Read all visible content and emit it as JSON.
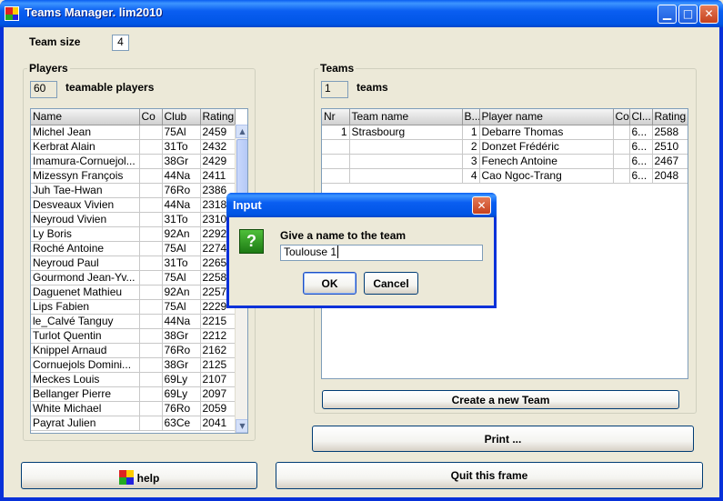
{
  "window": {
    "title": "Teams Manager. lim2010",
    "controls": [
      "minimize",
      "maximize",
      "close"
    ]
  },
  "team_size": {
    "label": "Team size",
    "value": "4"
  },
  "players": {
    "group_title": "Players",
    "count": "60",
    "count_label": "teamable players",
    "columns": [
      "Name",
      "Co",
      "Club",
      "Rating"
    ],
    "rows": [
      [
        "Michel Jean",
        "",
        "75Al",
        "2459"
      ],
      [
        "Kerbrat Alain",
        "",
        "31To",
        "2432"
      ],
      [
        "Imamura-Cornuejol...",
        "",
        "38Gr",
        "2429"
      ],
      [
        "Mizessyn François",
        "",
        "44Na",
        "2411"
      ],
      [
        "Juh Tae-Hwan",
        "",
        "76Ro",
        "2386"
      ],
      [
        "Desveaux Vivien",
        "",
        "44Na",
        "2318"
      ],
      [
        "Neyroud Vivien",
        "",
        "31To",
        "2310"
      ],
      [
        "Ly Boris",
        "",
        "92An",
        "2292"
      ],
      [
        "Roché Antoine",
        "",
        "75Al",
        "2274"
      ],
      [
        "Neyroud Paul",
        "",
        "31To",
        "2265"
      ],
      [
        "Gourmond Jean-Yv...",
        "",
        "75Al",
        "2258"
      ],
      [
        "Daguenet Mathieu",
        "",
        "92An",
        "2257"
      ],
      [
        "Lips Fabien",
        "",
        "75Al",
        "2229"
      ],
      [
        "le_Calvé Tanguy",
        "",
        "44Na",
        "2215"
      ],
      [
        "Turlot Quentin",
        "",
        "38Gr",
        "2212"
      ],
      [
        "Knippel Arnaud",
        "",
        "76Ro",
        "2162"
      ],
      [
        "Cornuejols Domini...",
        "",
        "38Gr",
        "2125"
      ],
      [
        "Meckes Louis",
        "",
        "69Ly",
        "2107"
      ],
      [
        "Bellanger Pierre",
        "",
        "69Ly",
        "2097"
      ],
      [
        "White Michael",
        "",
        "76Ro",
        "2059"
      ],
      [
        "Payrat Julien",
        "",
        "63Ce",
        "2041"
      ]
    ]
  },
  "teams": {
    "group_title": "Teams",
    "count": "1",
    "count_label": "teams",
    "columns": [
      "Nr",
      "Team name",
      "B...",
      "Player name",
      "Co",
      "Cl...",
      "Rating"
    ],
    "rows": [
      [
        "1",
        "Strasbourg",
        "1",
        "Debarre Thomas",
        "",
        "6...",
        "2588"
      ],
      [
        "",
        "",
        "2",
        "Donzet Frédéric",
        "",
        "6...",
        "2510"
      ],
      [
        "",
        "",
        "3",
        "Fenech Antoine",
        "",
        "6...",
        "2467"
      ],
      [
        "",
        "",
        "4",
        "Cao Ngoc-Trang",
        "",
        "6...",
        "2048"
      ]
    ],
    "create_button": "Create a new Team"
  },
  "buttons": {
    "print": "Print ...",
    "help": "help",
    "quit": "Quit this frame"
  },
  "dialog": {
    "title": "Input",
    "prompt": "Give a name to the team",
    "input_value": "Toulouse 1",
    "ok": "OK",
    "cancel": "Cancel",
    "icon": "question-icon"
  },
  "colors": {
    "title_bar": "#0a5ef1",
    "window_bg": "#ece9d8",
    "close_button": "#c6411d",
    "dialog_icon": "#2e9a22"
  }
}
